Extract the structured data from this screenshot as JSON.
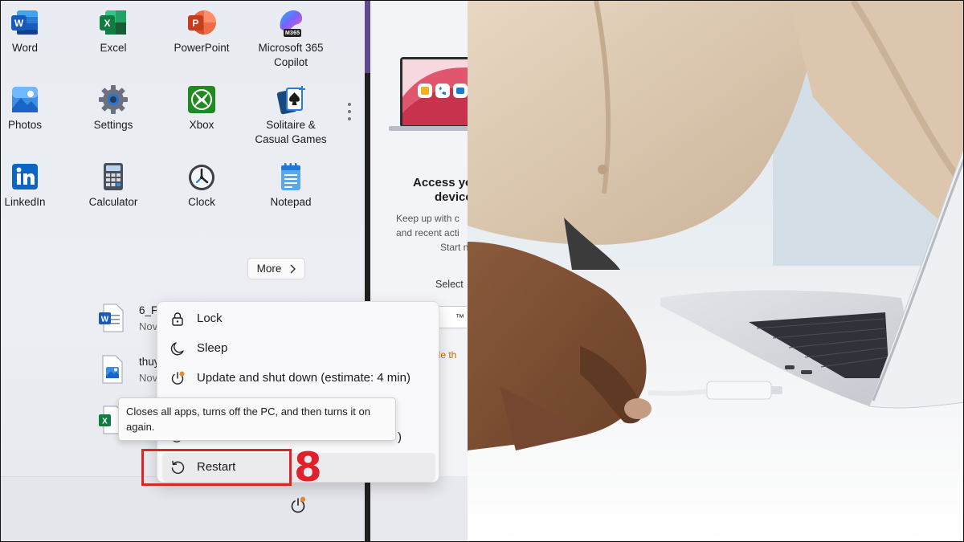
{
  "start_menu": {
    "pinned": [
      {
        "label": "Word",
        "icon": "word-icon"
      },
      {
        "label": "Excel",
        "icon": "excel-icon"
      },
      {
        "label": "PowerPoint",
        "icon": "powerpoint-icon"
      },
      {
        "label": "Microsoft 365 Copilot",
        "label_line1": "Microsoft 365",
        "label_line2": "Copilot",
        "icon": "copilot-icon",
        "badge": "M365"
      },
      {
        "label": "Photos",
        "icon": "photos-icon"
      },
      {
        "label": "Settings",
        "icon": "settings-icon"
      },
      {
        "label": "Xbox",
        "icon": "xbox-icon"
      },
      {
        "label": "Solitaire & Casual Games",
        "label_line1": "Solitaire &",
        "label_line2": "Casual Games",
        "icon": "solitaire-icon"
      },
      {
        "label": "LinkedIn",
        "icon": "linkedin-icon"
      },
      {
        "label": "Calculator",
        "icon": "calculator-icon"
      },
      {
        "label": "Clock",
        "icon": "clock-icon"
      },
      {
        "label": "Notepad",
        "icon": "notepad-icon"
      }
    ],
    "more_label": "More",
    "recommended": [
      {
        "title": "6_F",
        "subtitle": "Nov",
        "icon": "word-doc-icon"
      },
      {
        "title": "thuy",
        "subtitle": "Nov",
        "icon": "image-file-icon"
      },
      {
        "title": "",
        "subtitle": "",
        "icon": "excel-doc-icon"
      }
    ]
  },
  "power_menu": {
    "items": [
      {
        "label": "Lock",
        "icon": "lock-icon"
      },
      {
        "label": "Sleep",
        "icon": "sleep-icon"
      },
      {
        "label": "Update and shut down (estimate: 4 min)",
        "icon": "update-shutdown-icon"
      },
      {
        "label": "Restart",
        "icon": "restart-icon",
        "highlighted": true
      }
    ],
    "tooltip": "Closes all apps, turns off the PC, and then turns it on again."
  },
  "annotation": {
    "step_number": "8",
    "color": "#e0202a"
  },
  "phone_link_panel": {
    "title_line1": "Access yo",
    "title_line2": "device",
    "desc_line1": "Keep up with c",
    "desc_line2": "and recent acti",
    "desc_line3": "Start n",
    "select_label": "Select",
    "box_text": "™",
    "link_text": "ide th"
  },
  "colors": {
    "accent": "#0067c0",
    "highlight_box": "#d9262a",
    "update_dot": "#e8892b"
  }
}
